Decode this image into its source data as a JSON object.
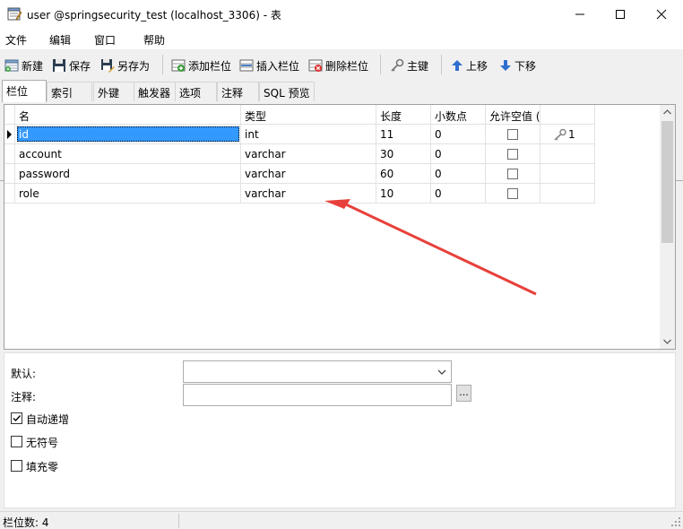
{
  "window": {
    "title": "user @springsecurity_test (localhost_3306) - 表"
  },
  "menu": {
    "items": [
      "文件",
      "编辑",
      "窗口",
      "帮助"
    ]
  },
  "toolbar": {
    "new_label": "新建",
    "save_label": "保存",
    "save_as_label": "另存为",
    "add_column_label": "添加栏位",
    "insert_column_label": "插入栏位",
    "delete_column_label": "删除栏位",
    "primary_key_label": "主键",
    "move_up_label": "上移",
    "move_down_label": "下移"
  },
  "tabs": [
    "栏位",
    "索引",
    "外键",
    "触发器",
    "选项",
    "注释",
    "SQL 预览"
  ],
  "active_tab": "栏位",
  "grid": {
    "columns": [
      "名",
      "类型",
      "长度",
      "小数点",
      "允许空值 ("
    ],
    "rows": [
      {
        "name": "id",
        "type": "int",
        "length": "11",
        "decimals": "0",
        "nullable": false,
        "key": "1",
        "selected": true
      },
      {
        "name": "account",
        "type": "varchar",
        "length": "30",
        "decimals": "0",
        "nullable": false,
        "key": "",
        "selected": false
      },
      {
        "name": "password",
        "type": "varchar",
        "length": "60",
        "decimals": "0",
        "nullable": false,
        "key": "",
        "selected": false
      },
      {
        "name": "role",
        "type": "varchar",
        "length": "10",
        "decimals": "0",
        "nullable": false,
        "key": "",
        "selected": false
      }
    ]
  },
  "properties": {
    "default_label": "默认:",
    "default_value": "",
    "comment_label": "注释:",
    "comment_value": "",
    "browse_label": "...",
    "auto_increment_label": "自动递增",
    "auto_increment_checked": true,
    "unsigned_label": "无符号",
    "unsigned_checked": false,
    "zerofill_label": "填充零",
    "zerofill_checked": false
  },
  "status": {
    "column_count": "栏位数: 4"
  },
  "colors": {
    "selection": "#3399ff",
    "annotation_arrow": "#e8403a",
    "toolbar_arrow": "#2f6fcf"
  }
}
